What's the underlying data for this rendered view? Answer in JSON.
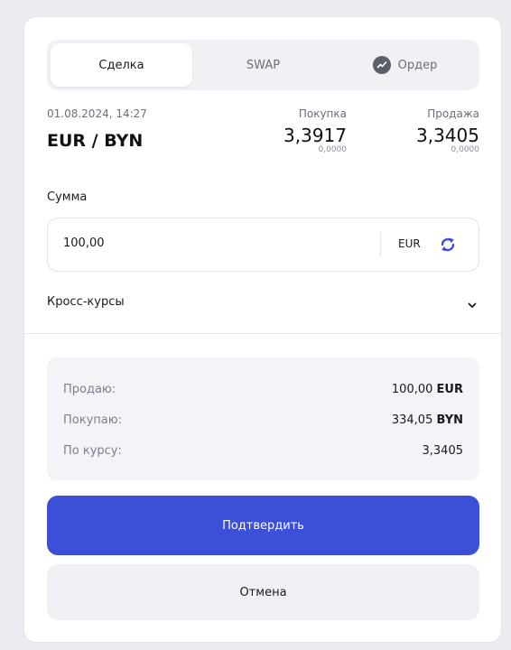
{
  "tabs": [
    {
      "label": "Сделка",
      "active": true
    },
    {
      "label": "SWAP",
      "active": false
    },
    {
      "label": "Ордер",
      "active": false,
      "icon": "trend-chart-icon"
    }
  ],
  "rate": {
    "datetime": "01.08.2024, 14:27",
    "pair": "EUR / BYN",
    "buy": {
      "label": "Покупка",
      "value": "3,3917",
      "change": "0,0000"
    },
    "sell": {
      "label": "Продажа",
      "value": "3,3405",
      "change": "0,0000"
    }
  },
  "amount": {
    "label": "Сумма",
    "value": "100,00",
    "currency": "EUR",
    "swap_icon": "refresh-icon"
  },
  "cross_rates": {
    "label": "Кросс-курсы",
    "icon": "chevron-down-icon"
  },
  "summary": {
    "sell_label": "Продаю:",
    "sell_amount": "100,00",
    "sell_currency": "EUR",
    "buy_label": "Покупаю:",
    "buy_amount": "334,05",
    "buy_currency": "BYN",
    "rate_label": "По курсу:",
    "rate_value": "3,3405"
  },
  "buttons": {
    "confirm": "Подтвердить",
    "cancel": "Отмена"
  },
  "colors": {
    "accent": "#3b50d6",
    "background": "#ececf0",
    "panel": "#f3f4f7"
  }
}
